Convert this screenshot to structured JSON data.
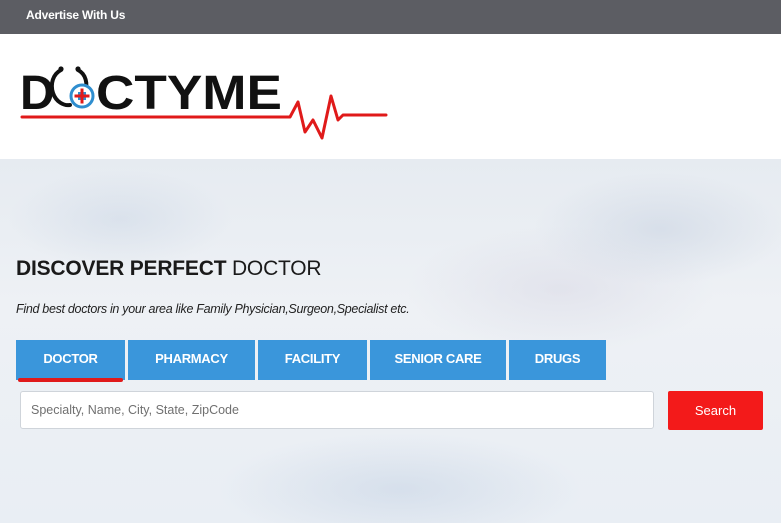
{
  "topbar": {
    "advertise_label": "Advertise With Us"
  },
  "brand": {
    "logo_text": "DOCTYME",
    "colors": {
      "logo_black": "#111111",
      "logo_blue": "#2f8ecf",
      "logo_red": "#e01a1a"
    }
  },
  "hero": {
    "title_bold": "DISCOVER PERFECT",
    "title_light": "DOCTOR",
    "subtitle": "Find best doctors in your area like Family Physician,Surgeon,Specialist etc."
  },
  "tabs": [
    {
      "label": "DOCTOR",
      "active": true
    },
    {
      "label": "PHARMACY",
      "active": false
    },
    {
      "label": "FACILITY",
      "active": false
    },
    {
      "label": "SENIOR CARE",
      "active": false
    },
    {
      "label": "DRUGS",
      "active": false
    }
  ],
  "search": {
    "value": "",
    "placeholder": "Specialty, Name, City, State, ZipCode",
    "button_label": "Search"
  },
  "colors": {
    "topbar": "#5c5d63",
    "tab_blue": "#3a96db",
    "active_underline": "#e01a1a",
    "search_button": "#f31a1a"
  }
}
